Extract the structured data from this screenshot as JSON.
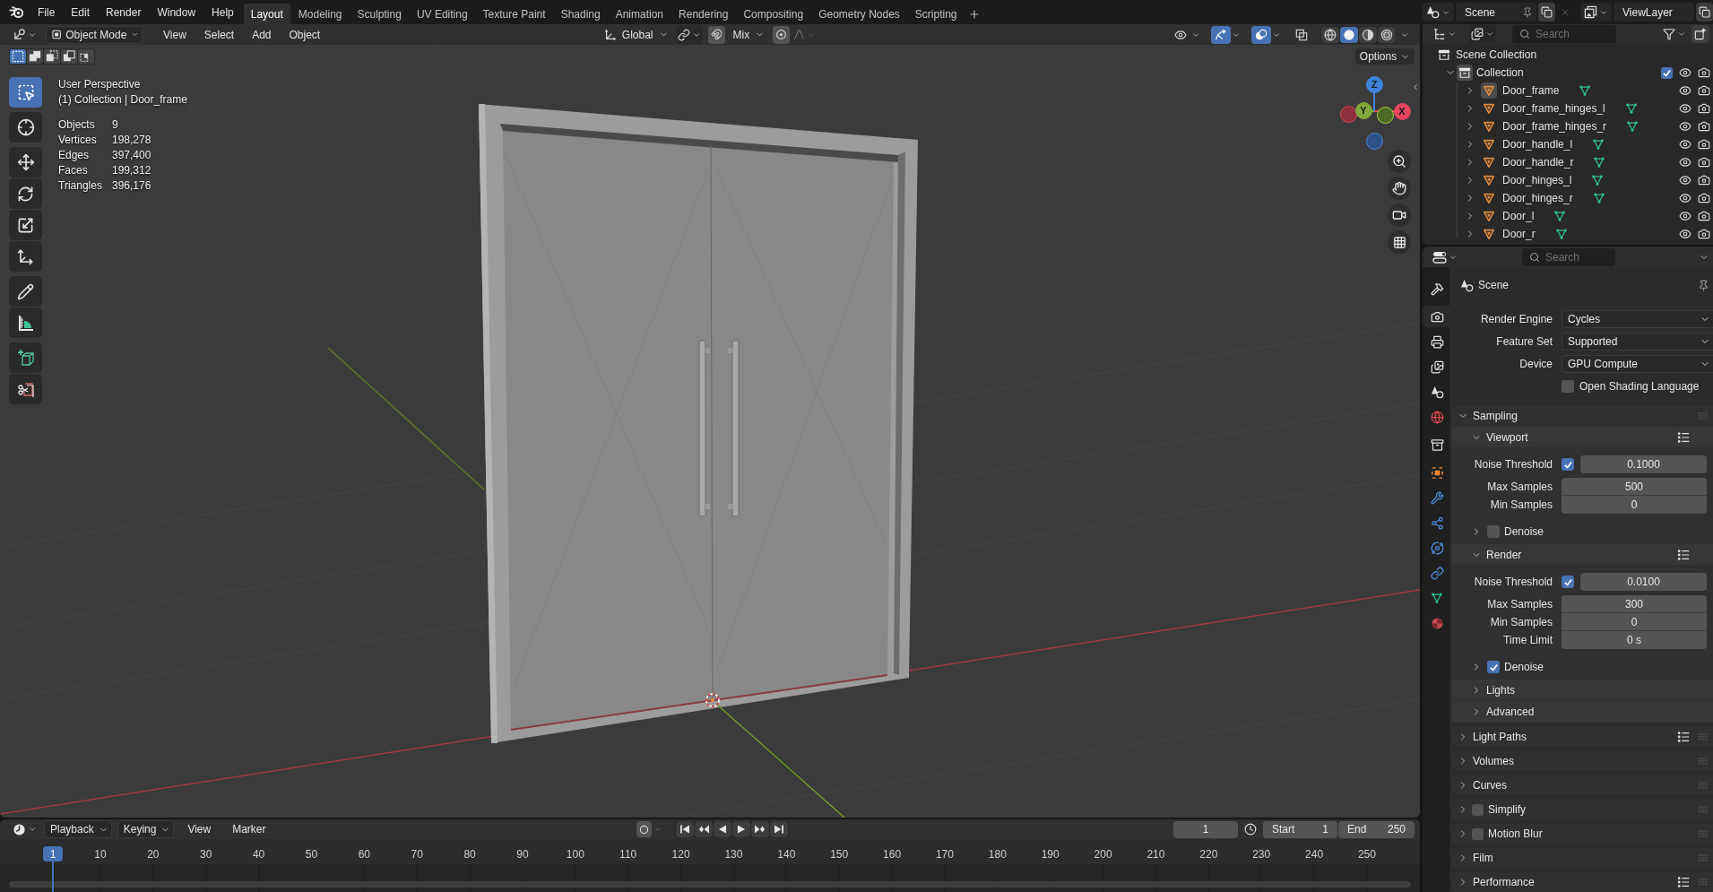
{
  "top_bar": {
    "menus": [
      "File",
      "Edit",
      "Render",
      "Window",
      "Help"
    ],
    "workspaces": [
      {
        "label": "Layout",
        "selected": true
      },
      {
        "label": "Modeling",
        "selected": false
      },
      {
        "label": "Sculpting",
        "selected": false
      },
      {
        "label": "UV Editing",
        "selected": false
      },
      {
        "label": "Texture Paint",
        "selected": false
      },
      {
        "label": "Shading",
        "selected": false
      },
      {
        "label": "Animation",
        "selected": false
      },
      {
        "label": "Rendering",
        "selected": false
      },
      {
        "label": "Compositing",
        "selected": false
      },
      {
        "label": "Geometry Nodes",
        "selected": false
      },
      {
        "label": "Scripting",
        "selected": false
      }
    ],
    "scene": "Scene",
    "view_layer": "ViewLayer"
  },
  "viewport": {
    "header": {
      "mode": "Object Mode",
      "menus": [
        "View",
        "Select",
        "Add",
        "Object"
      ],
      "orientation": "Global",
      "snapping": {
        "on": false
      },
      "snap_target": "Mix",
      "proportional": {
        "on": false
      },
      "toggles": [
        {
          "kind": "visibility",
          "on": false
        },
        {
          "kind": "gizmos",
          "on": true
        },
        {
          "kind": "overlays",
          "on": true
        },
        {
          "kind": "xray",
          "on": false
        }
      ],
      "shading": [
        {
          "kind": "wireframe",
          "selected": false
        },
        {
          "kind": "solid",
          "selected": true
        },
        {
          "kind": "material",
          "selected": false
        },
        {
          "kind": "rendered",
          "selected": false
        }
      ]
    },
    "select_modes": [
      {
        "kind": "set",
        "selected": true
      },
      {
        "kind": "extend",
        "selected": false
      },
      {
        "kind": "subtract",
        "selected": false
      },
      {
        "kind": "invert",
        "selected": false
      },
      {
        "kind": "intersect",
        "selected": false
      }
    ],
    "options": "Options",
    "tool_groups": [
      {
        "tools": [
          {
            "kind": "select-box",
            "selected": true
          }
        ]
      },
      {
        "tools": [
          {
            "kind": "cursor",
            "selected": false
          }
        ]
      },
      {
        "tools": [
          {
            "kind": "move",
            "selected": false
          },
          {
            "kind": "rotate",
            "selected": false
          },
          {
            "kind": "scale",
            "selected": false
          },
          {
            "kind": "transform",
            "selected": false
          }
        ]
      },
      {
        "tools": [
          {
            "kind": "annotate",
            "selected": false
          },
          {
            "kind": "measure",
            "selected": false
          }
        ]
      },
      {
        "tools": [
          {
            "kind": "add-cube",
            "selected": false
          },
          {
            "kind": "cut",
            "selected": false
          }
        ]
      }
    ],
    "view_name": "User Perspective",
    "context": "(1) Collection | Door_frame",
    "stats": [
      {
        "label": "Objects",
        "value": "9"
      },
      {
        "label": "Vertices",
        "value": "198,278"
      },
      {
        "label": "Edges",
        "value": "397,400"
      },
      {
        "label": "Faces",
        "value": "199,312"
      },
      {
        "label": "Triangles",
        "value": "396,176"
      }
    ],
    "gizmo_axes": [
      {
        "kind": "x",
        "label": "X"
      },
      {
        "kind": "y",
        "label": "Y"
      },
      {
        "kind": "z",
        "label": "Z"
      }
    ]
  },
  "timeline": {
    "menus": [
      {
        "label": "Playback",
        "dropdown": true
      },
      {
        "label": "Keying",
        "dropdown": true
      },
      {
        "label": "View",
        "dropdown": false
      },
      {
        "label": "Marker",
        "dropdown": false
      }
    ],
    "auto_keying": {
      "on": false
    },
    "current_frame": "1",
    "start": {
      "label": "Start",
      "value": "1"
    },
    "end": {
      "label": "End",
      "value": "250"
    },
    "playhead": "1",
    "ruler": [
      "10",
      "20",
      "30",
      "40",
      "50",
      "60",
      "70",
      "80",
      "90",
      "100",
      "110",
      "120",
      "130",
      "140",
      "150",
      "160",
      "170",
      "180",
      "190",
      "200",
      "210",
      "220",
      "230",
      "240",
      "250"
    ]
  },
  "outliner": {
    "search_placeholder": "Search",
    "tree": [
      {
        "kind": "scene-collection",
        "name": "Scene Collection",
        "children": [
          {
            "kind": "collection",
            "name": "Collection",
            "expanded": true,
            "active": true,
            "checked": true,
            "visible": true,
            "render": true,
            "children": [
              {
                "kind": "object",
                "name": "Door_frame",
                "expanded": false,
                "active": true,
                "visible": true,
                "render": true
              },
              {
                "kind": "object",
                "name": "Door_frame_hinges_l",
                "expanded": false,
                "active": false,
                "visible": true,
                "render": true
              },
              {
                "kind": "object",
                "name": "Door_frame_hinges_r",
                "expanded": false,
                "active": false,
                "visible": true,
                "render": true
              },
              {
                "kind": "object",
                "name": "Door_handle_l",
                "expanded": false,
                "active": false,
                "visible": true,
                "render": true
              },
              {
                "kind": "object",
                "name": "Door_handle_r",
                "expanded": false,
                "active": false,
                "visible": true,
                "render": true
              },
              {
                "kind": "object",
                "name": "Door_hinges_l",
                "expanded": false,
                "active": false,
                "visible": true,
                "render": true
              },
              {
                "kind": "object",
                "name": "Door_hinges_r",
                "expanded": false,
                "active": false,
                "visible": true,
                "render": true
              },
              {
                "kind": "object",
                "name": "Door_l",
                "expanded": false,
                "active": false,
                "visible": true,
                "render": true
              },
              {
                "kind": "object",
                "name": "Door_r",
                "expanded": false,
                "active": false,
                "visible": true,
                "render": true
              }
            ]
          }
        ]
      }
    ]
  },
  "properties": {
    "search_placeholder": "Search",
    "tab_groups": [
      {
        "tabs": [
          {
            "kind": "tool",
            "selected": false
          }
        ]
      },
      {
        "tabs": [
          {
            "kind": "render",
            "selected": true
          },
          {
            "kind": "output",
            "selected": false
          },
          {
            "kind": "view-layer",
            "selected": false
          },
          {
            "kind": "scene",
            "selected": false
          },
          {
            "kind": "world",
            "selected": false
          }
        ]
      },
      {
        "tabs": [
          {
            "kind": "collection",
            "selected": false
          }
        ]
      },
      {
        "tabs": [
          {
            "kind": "object",
            "selected": false
          },
          {
            "kind": "modifiers",
            "selected": false
          },
          {
            "kind": "particles",
            "selected": false
          },
          {
            "kind": "physics",
            "selected": false
          },
          {
            "kind": "constraints",
            "selected": false
          },
          {
            "kind": "data",
            "selected": false
          },
          {
            "kind": "material",
            "selected": false
          }
        ]
      }
    ],
    "context": "Scene",
    "fields": [
      {
        "label": "Render Engine",
        "value": "Cycles"
      },
      {
        "label": "Feature Set",
        "value": "Supported"
      },
      {
        "label": "Device",
        "value": "GPU Compute"
      }
    ],
    "osl": {
      "label": "Open Shading Language",
      "checked": false
    },
    "panels": [
      {
        "title": "Sampling",
        "expanded": true,
        "children": [
          {
            "title": "Viewport",
            "expanded": true,
            "presets": true,
            "rows": [
              {
                "label": "Noise Threshold",
                "value": "0.1000",
                "checked": true
              },
              {
                "label": "Max Samples",
                "value": "500"
              },
              {
                "label": "Min Samples",
                "value": "0"
              }
            ],
            "children": [
              {
                "title": "Denoise",
                "expanded": false,
                "checked": false
              }
            ]
          },
          {
            "title": "Render",
            "expanded": true,
            "presets": true,
            "rows": [
              {
                "label": "Noise Threshold",
                "value": "0.0100",
                "checked": true
              },
              {
                "label": "Max Samples",
                "value": "300"
              },
              {
                "label": "Min Samples",
                "value": "0"
              },
              {
                "label": "Time Limit",
                "value": "0 s"
              }
            ],
            "children": [
              {
                "title": "Denoise",
                "expanded": false,
                "checked": true
              }
            ]
          },
          {
            "title": "Lights",
            "expanded": false
          },
          {
            "title": "Advanced",
            "expanded": false
          }
        ]
      },
      {
        "title": "Light Paths",
        "expanded": false,
        "presets": true
      },
      {
        "title": "Volumes",
        "expanded": false
      },
      {
        "title": "Curves",
        "expanded": false
      },
      {
        "title": "Simplify",
        "expanded": false,
        "checked": false
      },
      {
        "title": "Motion Blur",
        "expanded": false,
        "checked": false
      },
      {
        "title": "Film",
        "expanded": false
      },
      {
        "title": "Performance",
        "expanded": false,
        "presets": true
      }
    ]
  }
}
